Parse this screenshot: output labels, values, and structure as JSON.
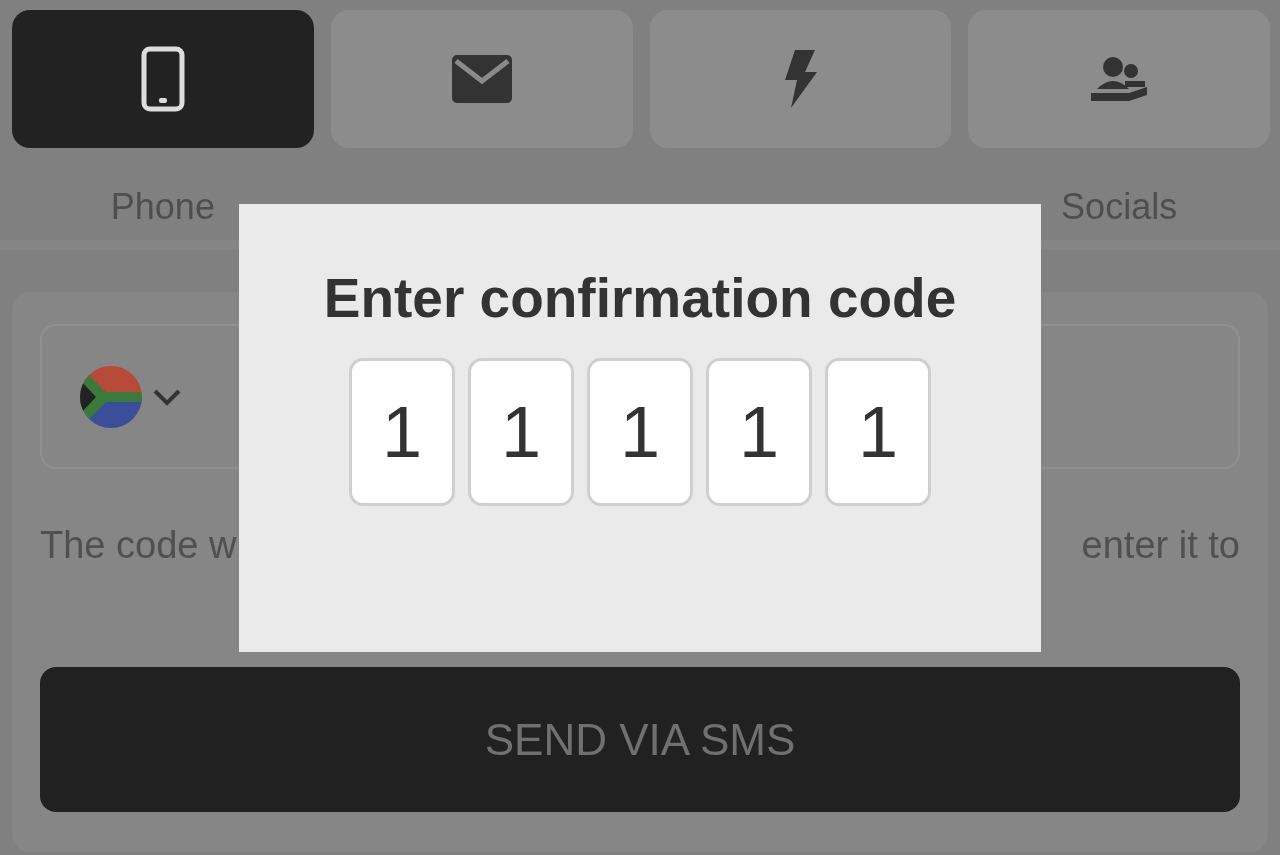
{
  "tabs": [
    {
      "label": "Phone",
      "selected": true,
      "kind": "phone"
    },
    {
      "selected": false,
      "kind": "email"
    },
    {
      "selected": false,
      "kind": "flash"
    },
    {
      "label": "Socials",
      "selected": false,
      "kind": "socials"
    }
  ],
  "note_fragments": [
    "The code w",
    "enter it to"
  ],
  "send_button": "SEND VIA SMS",
  "dialog": {
    "title": "Enter confirmation code",
    "code_digits": [
      "1",
      "1",
      "1",
      "1",
      "1"
    ]
  }
}
